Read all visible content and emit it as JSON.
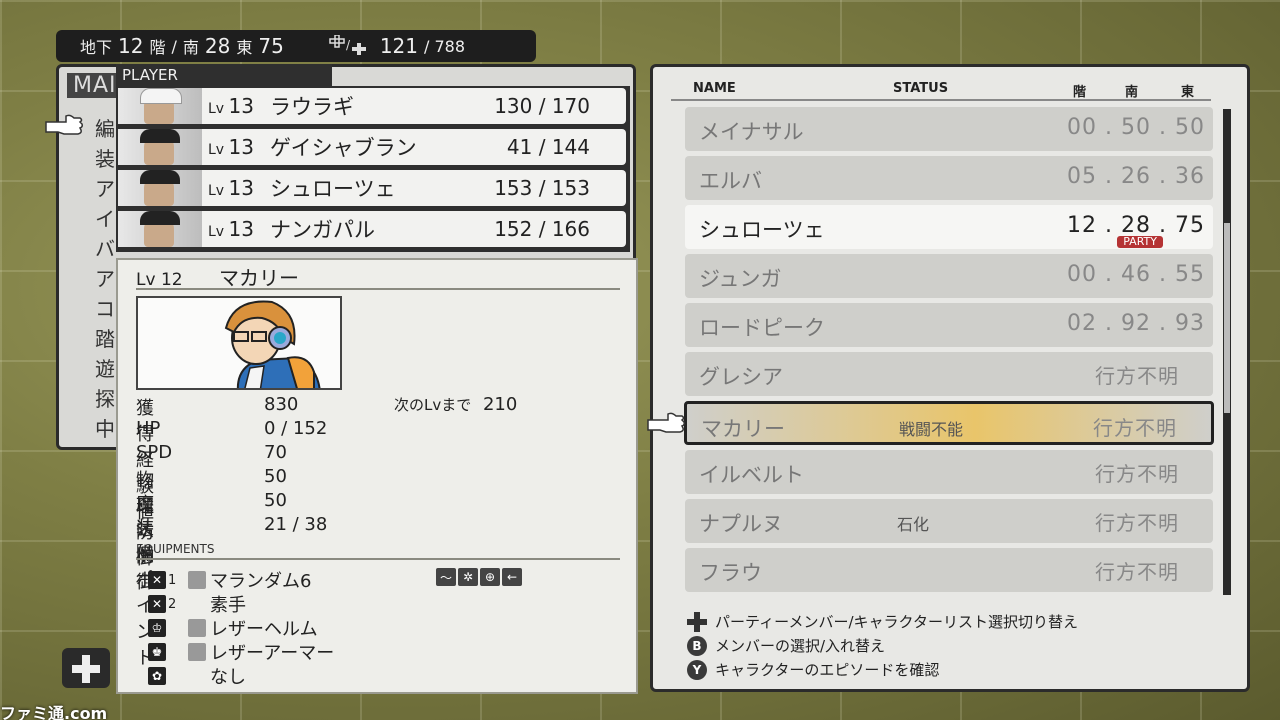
{
  "location": {
    "floor_prefix": "地下",
    "floor": "12",
    "floor_suffix": "階",
    "slash": "/",
    "south_label": "南",
    "south": "28",
    "east_label": "東",
    "east": "75",
    "steps": "121",
    "steps_max": "/ 788"
  },
  "main_menu": {
    "title": "MAIN",
    "items": [
      "編",
      "装",
      "ア",
      "イ",
      "バ",
      "ア",
      "コ",
      "踏",
      "遊",
      "探",
      "中"
    ]
  },
  "player": {
    "label": "PLAYER",
    "lv_prefix": "Lv",
    "members": [
      {
        "level": "13",
        "name": "ラウラギ",
        "hp": "130 / 170"
      },
      {
        "level": "13",
        "name": "ゲイシャブラン",
        "hp": "41 / 144"
      },
      {
        "level": "13",
        "name": "シュローツェ",
        "hp": "153 / 153"
      },
      {
        "level": "13",
        "name": "ナンガパル",
        "hp": "152 / 166"
      }
    ]
  },
  "detail": {
    "lv_prefix": "Lv",
    "level": "12",
    "name": "マカリー",
    "stats": [
      {
        "label": "獲得経験値",
        "value": "830"
      },
      {
        "label": "HP",
        "value": "0 / 152"
      },
      {
        "label": "SPD",
        "value": "70"
      },
      {
        "label": "物理防御",
        "value": "50"
      },
      {
        "label": "魔法防御",
        "value": "50"
      },
      {
        "label": "装備ポイント",
        "value": "21 / 38"
      }
    ],
    "next_lv_label": "次のLvまで",
    "next_lv_value": "210",
    "equipments_title": "EQUIPMENTS",
    "equipments": [
      {
        "slot_num": "1",
        "item": "マランダム6"
      },
      {
        "slot_num": "2",
        "item": "素手"
      },
      {
        "slot_num": "",
        "item": "レザーヘルム"
      },
      {
        "slot_num": "",
        "item": "レザーアーマー"
      },
      {
        "slot_num": "",
        "item": "なし"
      }
    ]
  },
  "roster": {
    "headers": {
      "name": "NAME",
      "status": "STATUS",
      "floor": "階",
      "south": "南",
      "east": "東"
    },
    "party_badge": "PARTY",
    "rows": [
      {
        "name": "メイナサル",
        "status": "",
        "location": "00 . 50 . 50"
      },
      {
        "name": "エルバ",
        "status": "",
        "location": "05 . 26 . 36"
      },
      {
        "name": "シュローツェ",
        "status": "",
        "location": "12 . 28 . 75"
      },
      {
        "name": "ジュンガ",
        "status": "",
        "location": "00 . 46 . 55"
      },
      {
        "name": "ロードピーク",
        "status": "",
        "location": "02 . 92 . 93"
      },
      {
        "name": "グレシア",
        "status": "",
        "location": "行方不明"
      },
      {
        "name": "マカリー",
        "status": "戦闘不能",
        "location": "行方不明"
      },
      {
        "name": "イルベルト",
        "status": "",
        "location": "行方不明"
      },
      {
        "name": "ナプルヌ",
        "status": "石化",
        "location": "行方不明"
      },
      {
        "name": "フラウ",
        "status": "",
        "location": "行方不明"
      }
    ],
    "help": [
      {
        "button": "",
        "text": "パーティーメンバー/キャラクターリスト選択切り替え"
      },
      {
        "button": "B",
        "text": "メンバーの選択/入れ替え"
      },
      {
        "button": "Y",
        "text": "キャラクターのエピソードを確認"
      }
    ]
  },
  "watermark": "ファミ通.com",
  "colors": {
    "party_badge": "#b53334",
    "selected_row": "#e9c56a",
    "panel": "#e8e8e5"
  }
}
